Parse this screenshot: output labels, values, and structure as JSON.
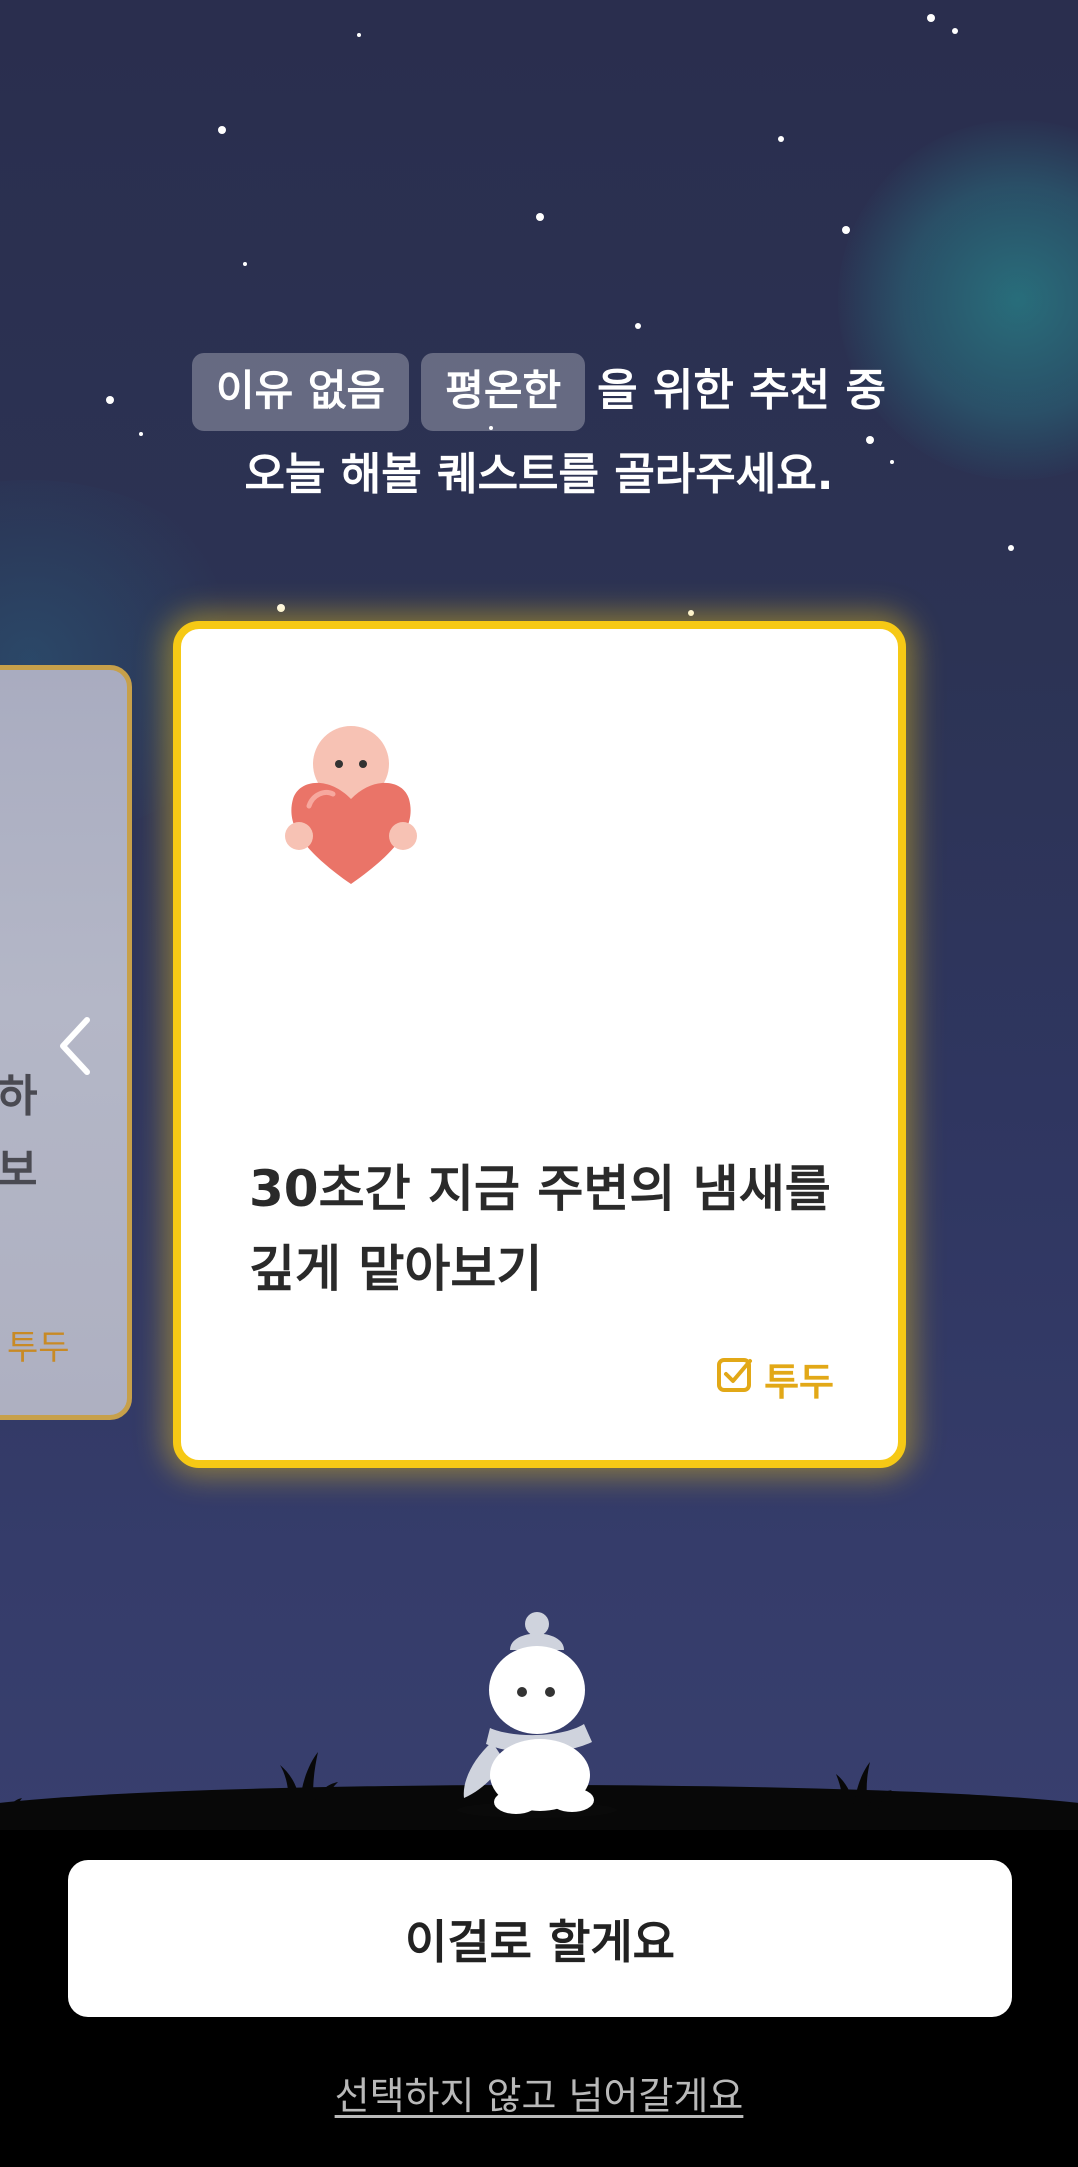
{
  "prompt": {
    "chip_reason": "이유 없음",
    "chip_mood": "평온한",
    "line1_suffix": "을 위한 추천 중",
    "line2": "오늘 해볼 퀘스트를 골라주세요."
  },
  "previous_card": {
    "partial_text": "하\n보",
    "tag": "투두"
  },
  "current_card": {
    "icon": "baby-heart-icon",
    "title": "30초간 지금 주변의 냄새를 깊게 맡아보기",
    "tag": "투두",
    "tag_icon": "checkbox-icon"
  },
  "actions": {
    "confirm": "이걸로 할게요",
    "skip": "선택하지 않고 넘어갈게요"
  },
  "colors": {
    "card_border": "#f6c915",
    "tag": "#e2a817",
    "background": "#2c3354"
  }
}
